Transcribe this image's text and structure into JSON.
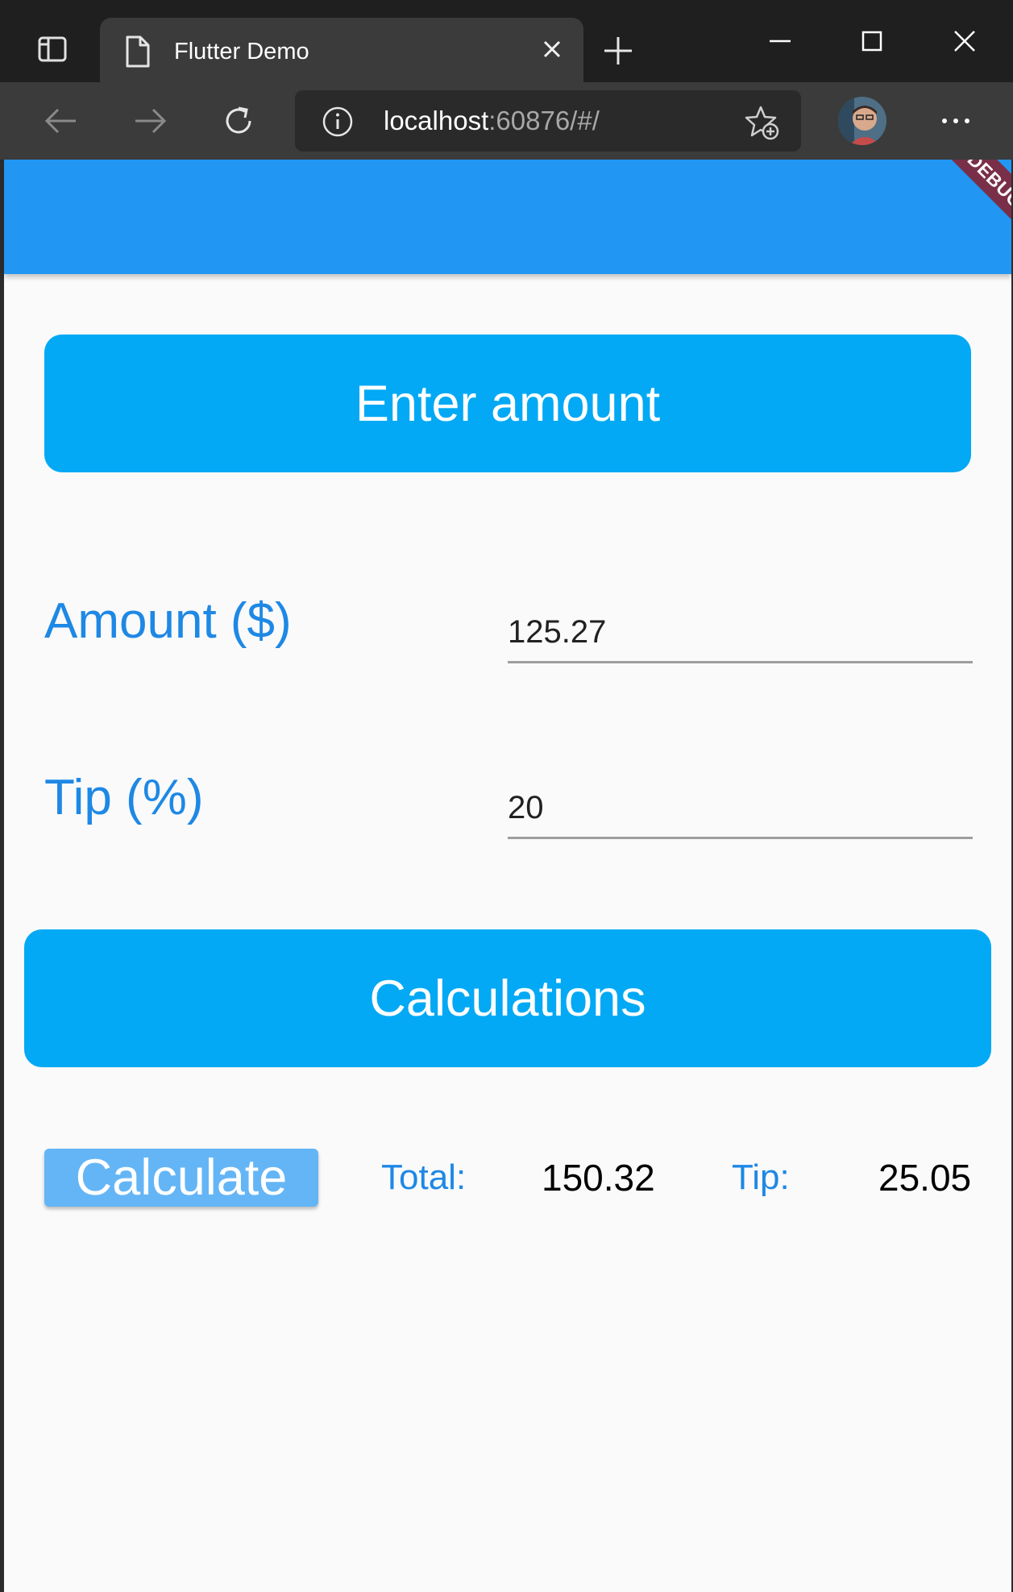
{
  "browser": {
    "tab_title": "Flutter Demo",
    "url_host": "localhost",
    "url_path": ":60876/#/",
    "icons": {
      "tab_actions": "tab-actions-icon",
      "favicon": "page-icon",
      "tab_close": "close-icon",
      "new_tab": "plus-icon",
      "minimize": "minimize-icon",
      "maximize": "maximize-icon",
      "close_window": "close-icon",
      "back": "arrow-left-icon",
      "forward": "arrow-right-icon",
      "reload": "reload-icon",
      "site_info": "info-icon",
      "favorites": "add-favorite-icon",
      "profile": "avatar",
      "menu": "more-icon"
    }
  },
  "app": {
    "debug_banner": "DEBUG",
    "enter_header": "Enter amount",
    "amount_label": "Amount ($)",
    "amount_value": "125.27",
    "tip_label": "Tip (%)",
    "tip_value": "20",
    "calc_header": "Calculations",
    "calculate_button": "Calculate",
    "total_label": "Total:",
    "total_value": "150.32",
    "tip_result_label": "Tip:",
    "tip_result_value": "25.05"
  },
  "colors": {
    "app_bar": "#2196f3",
    "header_buttons": "#03a9f4",
    "label_text": "#1e88e5",
    "calculate_button": "#64b5f6",
    "debug_banner": "#7a2f49"
  }
}
